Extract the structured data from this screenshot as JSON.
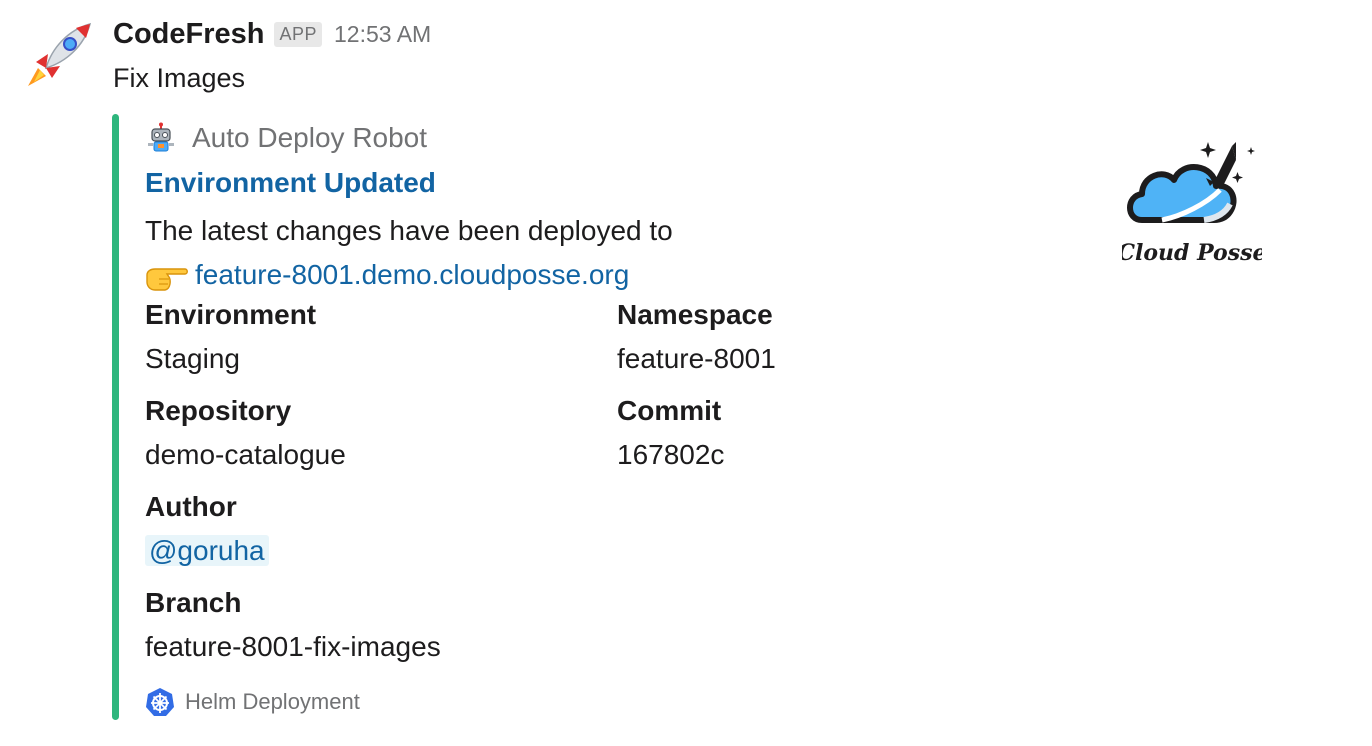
{
  "message": {
    "sender": "CodeFresh",
    "badge": "APP",
    "timestamp": "12:53 AM",
    "text": "Fix Images",
    "avatar_icon": "rocket-icon"
  },
  "attachment": {
    "bar_color": "#2eb67d",
    "author_icon": "robot-icon",
    "author_name": "Auto Deploy Robot",
    "title": "Environment Updated",
    "text_line": "The latest changes have been deployed to",
    "pointer_icon": "pointing-hand-icon",
    "link": "feature-8001.demo.cloudposse.org",
    "thumb": {
      "icon": "cloud-posse-logo",
      "brand_text": "Cloud Posse"
    },
    "fields": [
      {
        "title": "Environment",
        "value": "Staging"
      },
      {
        "title": "Namespace",
        "value": "feature-8001"
      },
      {
        "title": "Repository",
        "value": "demo-catalogue"
      },
      {
        "title": "Commit",
        "value": "167802c"
      },
      {
        "title": "Author",
        "value": "@goruha"
      },
      {
        "title": "Branch",
        "value": "feature-8001-fix-images"
      }
    ],
    "footer_icon": "helm-icon",
    "footer": "Helm Deployment"
  }
}
